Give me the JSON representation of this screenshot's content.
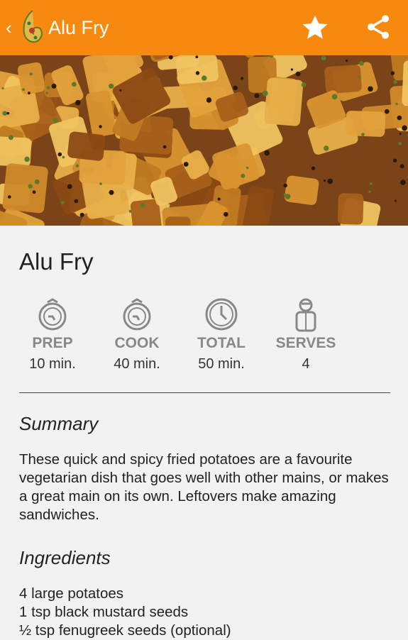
{
  "appbar": {
    "title": "Alu Fry",
    "back_icon": "back-chevron-icon",
    "logo_icon": "paisley-logo-icon",
    "actions": [
      "star-icon",
      "share-icon"
    ],
    "color": "#f7890f"
  },
  "recipe": {
    "name": "Alu Fry",
    "stats": [
      {
        "label": "PREP",
        "value": "10 min.",
        "icon": "prep-timer-icon"
      },
      {
        "label": "COOK",
        "value": "40 min.",
        "icon": "cook-timer-icon"
      },
      {
        "label": "TOTAL",
        "value": "50 min.",
        "icon": "clock-icon"
      },
      {
        "label": "SERVES",
        "value": "4",
        "icon": "person-icon"
      }
    ],
    "summary_heading": "Summary",
    "summary": "These quick and spicy fried potatoes are a favourite vegetarian dish that goes well with other mains, or makes a great main on its own.  Leftovers make amazing sandwiches.",
    "ingredients_heading": "Ingredients",
    "ingredients": [
      "4 large potatoes",
      "1 tsp black mustard seeds",
      "½ tsp fenugreek seeds (optional)"
    ]
  }
}
